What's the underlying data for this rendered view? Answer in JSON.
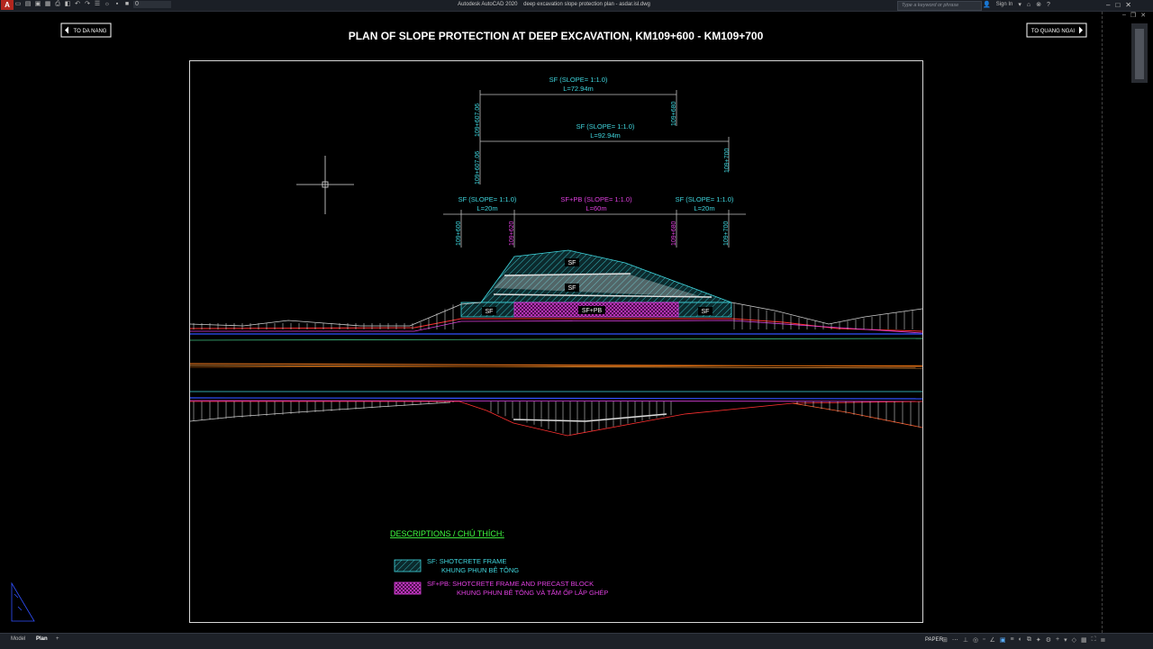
{
  "window": {
    "app_name": "Autodesk AutoCAD 2020",
    "document_name": "deep excavation slope protection plan - asdar.isl.dwg",
    "app_menu_letter": "A"
  },
  "quick_access": {
    "icons": [
      "new-icon",
      "open-icon",
      "save-icon",
      "save-as-icon",
      "print-icon",
      "plot-icon",
      "undo-icon",
      "redo-icon",
      "layer-icon",
      "sun-icon",
      "lock-icon",
      "color-swatch-icon"
    ],
    "layer_value": "0"
  },
  "search": {
    "placeholder": "Type a keyword or phrase"
  },
  "account": {
    "sign_in_label": "Sign In"
  },
  "drawing": {
    "title": "PLAN OF SLOPE PROTECTION AT DEEP EXCAVATION, KM109+600 - KM109+700",
    "left_direction": "TO DA NANG",
    "right_direction": "TO QUANG NGAI",
    "dims": [
      {
        "label": "SF (SLOPE= 1:1.0)",
        "length": "L=72.94m",
        "start": "109+607.06",
        "end": "109+680"
      },
      {
        "label": "SF (SLOPE= 1:1.0)",
        "length": "L=92.94m",
        "start": "109+607.06",
        "end": "109+700"
      }
    ],
    "segments": [
      {
        "label": "SF (SLOPE= 1:1.0)",
        "length": "L=20m"
      },
      {
        "label": "SF+PB (SLOPE= 1:1.0)",
        "length": "L=60m"
      },
      {
        "label": "SF (SLOPE= 1:1.0)",
        "length": "L=20m"
      }
    ],
    "stations": [
      "109+600",
      "109+620",
      "109+680",
      "109+700"
    ],
    "hatch_labels": {
      "sf": "SF",
      "sfpb": "SF+PB"
    },
    "legend": {
      "heading": "DESCRIPTIONS / CHÚ THÍCH:",
      "items": [
        {
          "line1": "SF: SHOTCRETE FRAME",
          "line2": "KHUNG PHUN BÊ TÔNG",
          "color": "#40d8e0"
        },
        {
          "line1": "SF+PB: SHOTCRETE FRAME AND PRECAST BLOCK",
          "line2": "KHUNG PHUN BÊ TÔNG VÀ TẤM ỐP LẮP GHÉP",
          "color": "#e040e0"
        }
      ]
    },
    "colors": {
      "cyan": "#40d8e0",
      "magenta": "#e040e0",
      "green": "#40ff40",
      "red": "#ff3030",
      "blue": "#3050ff"
    }
  },
  "status": {
    "tabs": [
      "Model",
      "Plan"
    ],
    "active_tab": "Plan",
    "add_tab": "+",
    "paper_label": "PAPER"
  }
}
